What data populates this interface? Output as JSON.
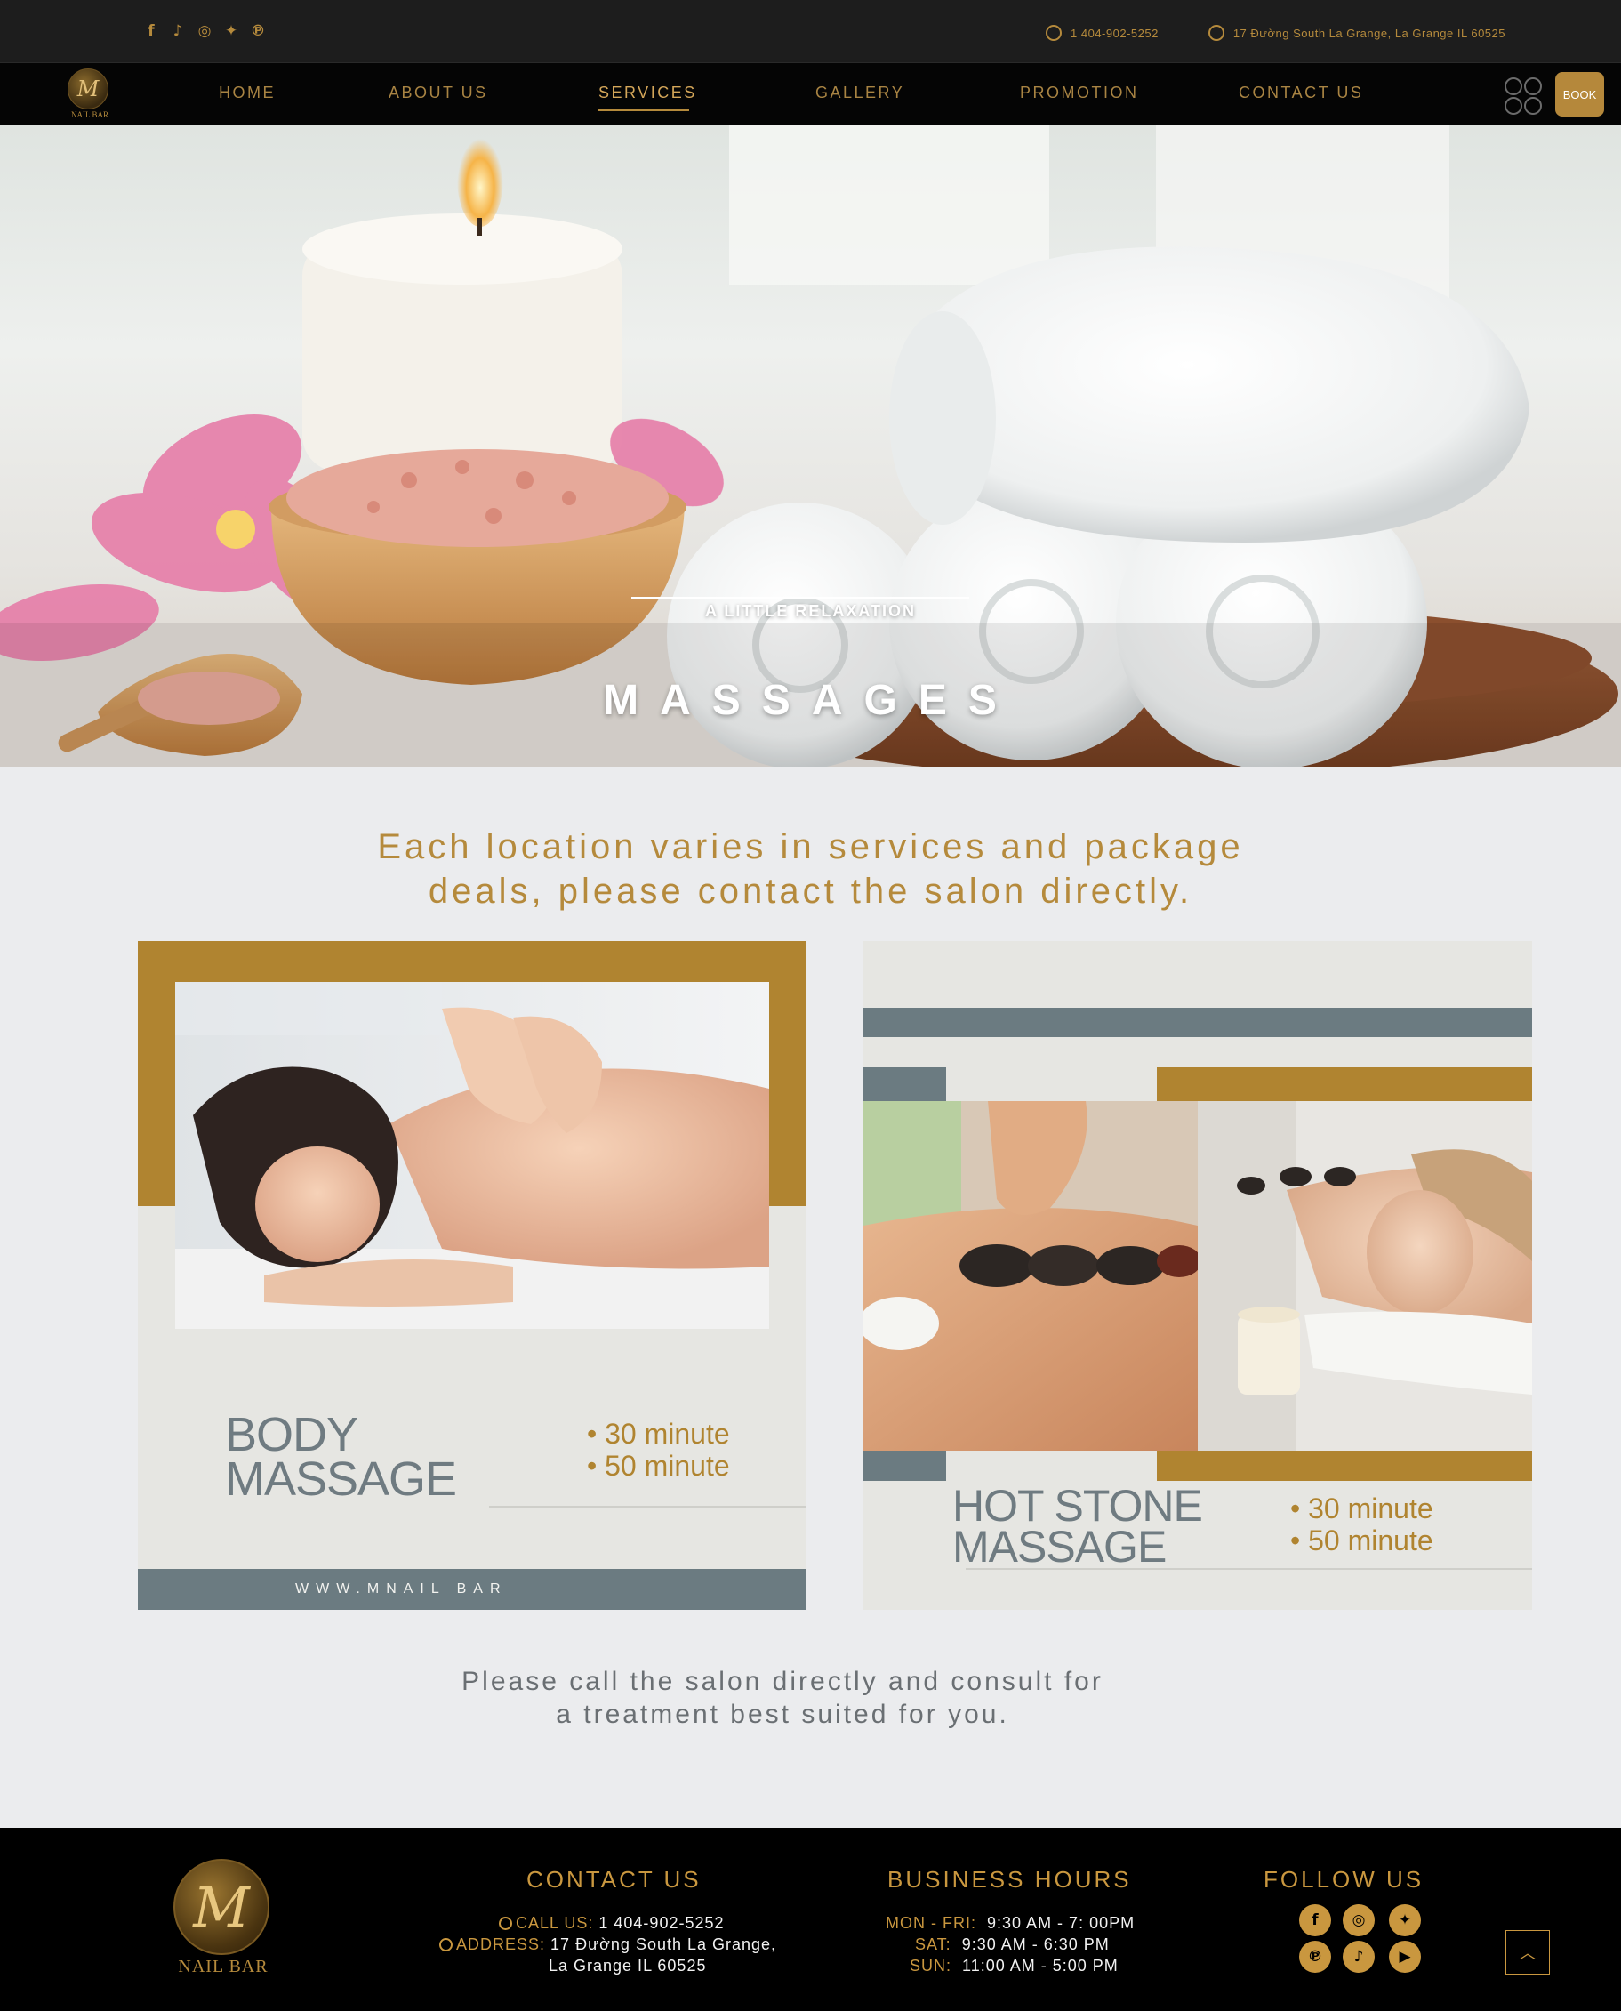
{
  "topbar": {
    "social_icons": [
      "facebook-icon",
      "tiktok-icon",
      "instagram-icon",
      "twitter-icon",
      "pinterest-icon"
    ],
    "phone": "1 404-902-5252",
    "address": "17 Đường South La Grange, La Grange IL 60525"
  },
  "nav": {
    "logo_text": "NAIL BAR",
    "items": [
      "HOME",
      "ABOUT US",
      "SERVICES",
      "GALLERY",
      "PROMOTION",
      "CONTACT US"
    ],
    "active": "SERVICES",
    "book_label": "BOOK"
  },
  "hero": {
    "title": "MASSAGES",
    "subtitle": "A LITTLE RELAXATION"
  },
  "intro": {
    "line1": "Each location varies in services and package",
    "line2": "deals, please contact the salon directly."
  },
  "cards": [
    {
      "title_line1": "BODY",
      "title_line2": "MASSAGE",
      "options": [
        "• 30 minute",
        "• 50 minute"
      ],
      "footer": "WWW.MNAIL BAR"
    },
    {
      "title_line1": "HOT STONE",
      "title_line2": "MASSAGE",
      "options": [
        "• 30 minute",
        "• 50 minute"
      ]
    }
  ],
  "consult": {
    "line1": "Please call the salon directly and consult for",
    "line2": "a treatment best suited for you."
  },
  "footer": {
    "logo_text": "NAIL BAR",
    "contact_heading": "CONTACT US",
    "call_label": "CALL US:",
    "call_value": "1 404-902-5252",
    "address_label": "ADDRESS:",
    "address_line1": "17 Đường South La Grange,",
    "address_line2": "La Grange IL 60525",
    "hours_heading": "BUSINESS HOURS",
    "hours": [
      {
        "day": "MON - FRI:",
        "time": "9:30 AM - 7: 00PM"
      },
      {
        "day": "SAT:",
        "time": "9:30 AM - 6:30 PM"
      },
      {
        "day": "SUN:",
        "time": "11:00 AM - 5:00 PM"
      }
    ],
    "follow_heading": "FOLLOW US",
    "social_icons": [
      "facebook-icon",
      "instagram-icon",
      "twitter-icon",
      "pinterest-icon",
      "tiktok-icon",
      "youtube-icon"
    ]
  },
  "colors": {
    "gold": "#b08430",
    "slate": "#6b7b81",
    "card_bg": "#e6e6e2",
    "page_bg": "#ebecee",
    "black": "#000000"
  }
}
